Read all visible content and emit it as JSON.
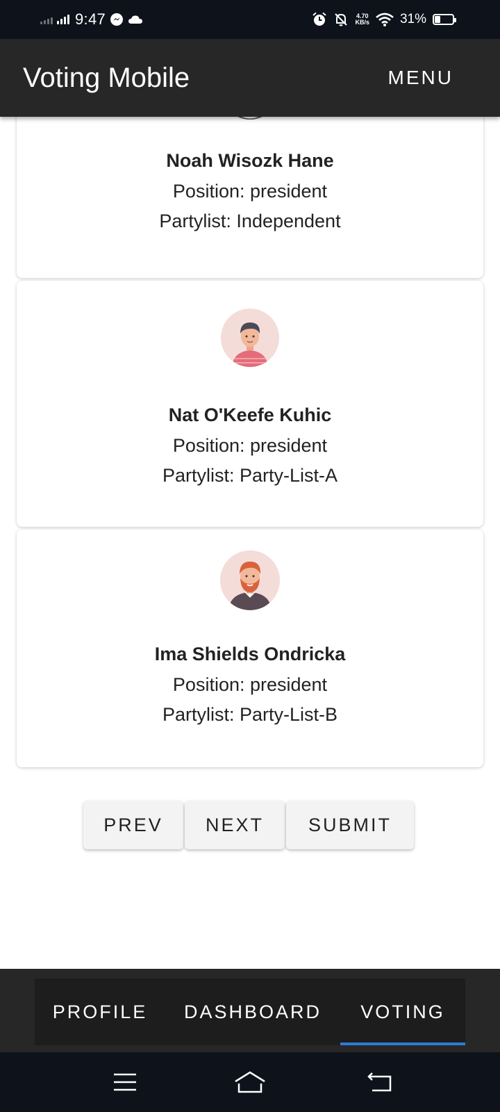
{
  "status_bar": {
    "time": "9:47",
    "net_speed_value": "4.70",
    "net_speed_unit": "KB/s",
    "battery_text": "31%",
    "battery_level": 0.31,
    "icons": [
      "signal-icon",
      "messenger-icon",
      "cloud-icon",
      "alarm-icon",
      "mute-icon",
      "wifi-icon",
      "battery-icon"
    ]
  },
  "app_bar": {
    "title": "Voting Mobile",
    "menu_label": "MENU"
  },
  "candidates": [
    {
      "name": "Noah Wisozk Hane",
      "position": "Position: president",
      "partylist": "Partylist: Independent"
    },
    {
      "name": "Nat O'Keefe Kuhic",
      "position": "Position: president",
      "partylist": "Partylist: Party-List-A"
    },
    {
      "name": "Ima Shields Ondricka",
      "position": "Position: president",
      "partylist": "Partylist: Party-List-B"
    }
  ],
  "actions": {
    "prev": "PREV",
    "next": "NEXT",
    "submit": "SUBMIT"
  },
  "bottom_nav": {
    "tabs": [
      "PROFILE",
      "DASHBOARD",
      "VOTING"
    ],
    "active": "VOTING",
    "accent": "#2f7ad6"
  },
  "colors": {
    "app_bar": "#272727",
    "status_bar": "#0d121b",
    "avatar_bg": "#f4dcd9"
  }
}
